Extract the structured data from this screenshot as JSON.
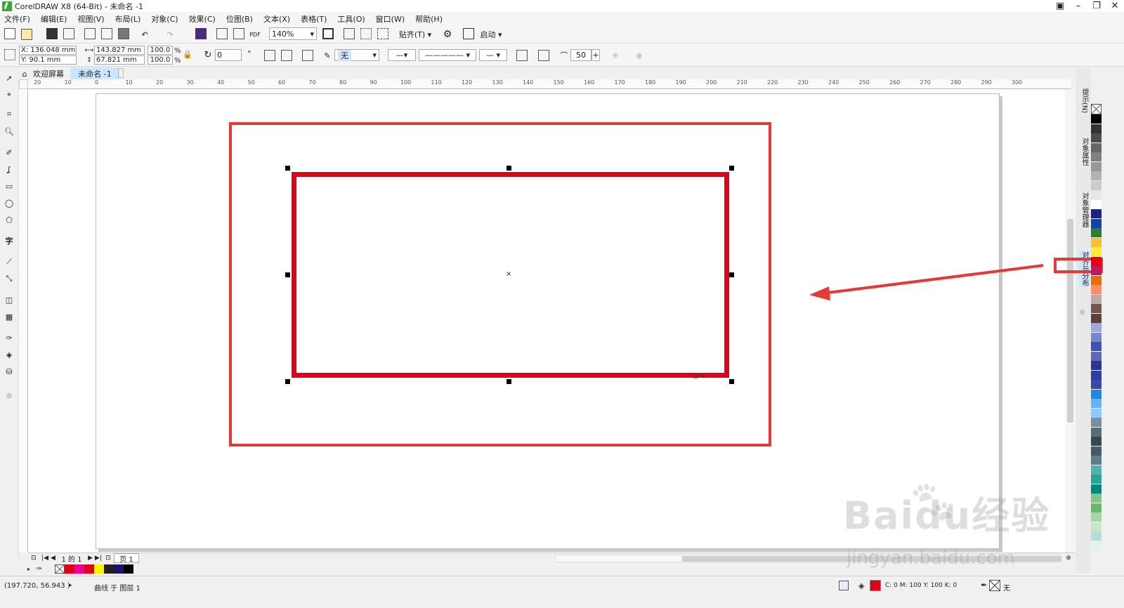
{
  "window": {
    "title": "CorelDRAW X8 (64-Bit) - 未命名 -1"
  },
  "menu": [
    "文件(F)",
    "编辑(E)",
    "视图(V)",
    "布局(L)",
    "对象(C)",
    "效果(C)",
    "位图(B)",
    "文本(X)",
    "表格(T)",
    "工具(O)",
    "窗口(W)",
    "帮助(H)"
  ],
  "toolbar1": {
    "zoom": "140%",
    "snap_label": "贴齐(T)",
    "launch_label": "启动"
  },
  "props": {
    "x": "X: 136.048 mm",
    "y": "Y: 90.1 mm",
    "w": "143.827 mm",
    "h": "67.821 mm",
    "sx": "100.0",
    "sy": "100.0",
    "pct": "%",
    "angle": "0",
    "fill": "无",
    "smooth": "50"
  },
  "tabs": {
    "welcome": "欢迎屏幕",
    "doc": "未命名 -1"
  },
  "ruler_h": [
    "20",
    "10",
    "0",
    "10",
    "20",
    "30",
    "40",
    "50",
    "60",
    "70",
    "80",
    "90",
    "100",
    "110",
    "120",
    "130",
    "140",
    "150",
    "160",
    "170",
    "180",
    "190",
    "200",
    "210",
    "220",
    "230",
    "240",
    "250",
    "260",
    "270",
    "280",
    "290",
    "300"
  ],
  "dockers": {
    "hints": "提示(N)",
    "props": "对象属性",
    "manager": "对象管理器",
    "align": "对齐与分布"
  },
  "page_nav": {
    "counter": "1 的 1",
    "tab": "页 1"
  },
  "status": {
    "coords": "(197.720, 56.943 )",
    "info": "曲线 于 图层 1",
    "color": "C: 0 M: 100 Y: 100 K: 0",
    "outline": "无"
  },
  "watermark": {
    "brand": "Baidu经验",
    "url": "jingyan.baidu.com"
  },
  "colors": {
    "accent": "#e0001a",
    "highlight": "#e53935"
  },
  "palette_colors": [
    "#000000",
    "#333333",
    "#4d4d4d",
    "#666666",
    "#808080",
    "#999999",
    "#b3b3b3",
    "#cccccc",
    "#e6e6e6",
    "#ffffff",
    "#1a237e",
    "#0d47a1",
    "#2e7d32",
    "#fbc02d",
    "#ffeb3b",
    "#e0001a",
    "#c2185b",
    "#ef6c00",
    "#ff8a65",
    "#bcaaa4",
    "#795548",
    "#5d4037",
    "#9fa8da",
    "#7986cb",
    "#3f51b5",
    "#5c6bc0",
    "#283593",
    "#303f9f",
    "#3949ab",
    "#1e88e5",
    "#64b5f6",
    "#90caf9",
    "#78909c",
    "#546e7a",
    "#37474f",
    "#455a64",
    "#607d8b",
    "#4db6ac",
    "#26a69a",
    "#00897b",
    "#81c784",
    "#66bb6a",
    "#a5d6a7",
    "#c8e6c9",
    "#b2dfdb",
    "#e0f2f1"
  ],
  "doc_palette": [
    "#e0001a",
    "#ec008c",
    "#e0001a",
    "#fff200",
    "#231f20",
    "#1b1464",
    "#000000"
  ]
}
